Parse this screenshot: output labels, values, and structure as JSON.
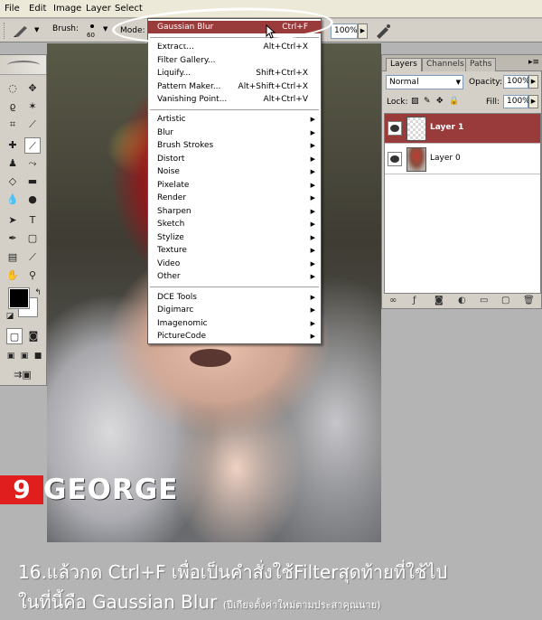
{
  "menubar": {
    "items": [
      "File",
      "Edit",
      "Image",
      "Layer",
      "Select"
    ]
  },
  "options_bar": {
    "brush_label": "Brush:",
    "brush_size": "60",
    "mode_label": "Mode:",
    "flow_value": "100%"
  },
  "filter_menu": {
    "last_filter": {
      "label": "Gaussian Blur",
      "shortcut": "Ctrl+F"
    },
    "group1": [
      {
        "label": "Extract...",
        "shortcut": "Alt+Ctrl+X"
      },
      {
        "label": "Filter Gallery...",
        "shortcut": ""
      },
      {
        "label": "Liquify...",
        "shortcut": "Shift+Ctrl+X"
      },
      {
        "label": "Pattern Maker...",
        "shortcut": "Alt+Shift+Ctrl+X"
      },
      {
        "label": "Vanishing Point...",
        "shortcut": "Alt+Ctrl+V"
      }
    ],
    "group2": [
      "Artistic",
      "Blur",
      "Brush Strokes",
      "Distort",
      "Noise",
      "Pixelate",
      "Render",
      "Sharpen",
      "Sketch",
      "Stylize",
      "Texture",
      "Video",
      "Other"
    ],
    "group3": [
      "DCE Tools",
      "Digimarc",
      "Imagenomic",
      "PictureCode"
    ]
  },
  "layers_panel": {
    "tabs": [
      "Layers",
      "Channels",
      "Paths"
    ],
    "blend_mode": "Normal",
    "opacity_label": "Opacity:",
    "opacity_value": "100%",
    "lock_label": "Lock:",
    "fill_label": "Fill:",
    "fill_value": "100%",
    "layers": [
      {
        "name": "Layer 1",
        "selected": true
      },
      {
        "name": "Layer 0",
        "selected": false
      }
    ]
  },
  "branding": {
    "logo_mark": "9",
    "logo_word": "GEORGE"
  },
  "caption": {
    "line1": "16.แล้วกด Ctrl+F เพื่อเป็นคำสั่งใช้Filterสุดท้ายที่ใช้ไป",
    "line2": "ในที่นี้คือ Gaussian Blur",
    "line2_note": "(ปีเกียจตั้งค่าใหม่ตามประสาคุณนาย)"
  },
  "colors": {
    "highlight": "#9a3b3b",
    "logo_red": "#e01e1e",
    "panel": "#d4d0c8",
    "page_bg": "#b4b4b4"
  }
}
